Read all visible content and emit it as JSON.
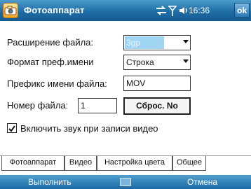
{
  "window": {
    "title": "Фотоаппарат",
    "clock": "16:36",
    "ok_label": "ok",
    "status_icons": [
      "connectivity-icon",
      "signal-icon",
      "volume-icon"
    ]
  },
  "form": {
    "file_extension": {
      "label": "Расширение файла:",
      "value": "3gp"
    },
    "prefix_format": {
      "label": "Формат преф.имени",
      "value": "Строка"
    },
    "file_prefix": {
      "label": "Префикс имени файла:",
      "value": "MOV"
    },
    "file_number": {
      "label": "Номер файла:",
      "value": "1"
    },
    "reset_button": "Сброс. No",
    "sound_checkbox": {
      "label": "Включить звук при записи видео",
      "checked": true
    }
  },
  "tabs": [
    {
      "label": "Фотоаппарат",
      "active": false
    },
    {
      "label": "Видео",
      "active": true
    },
    {
      "label": "Настройка цвета",
      "active": false
    },
    {
      "label": "Общее",
      "active": false
    }
  ],
  "menubar": {
    "left": "Выполнить",
    "right": "Отмена",
    "center_icon": "keyboard-icon"
  },
  "colors": {
    "titlebar": "#1e6ea8",
    "selection": "#9fd4f2"
  }
}
